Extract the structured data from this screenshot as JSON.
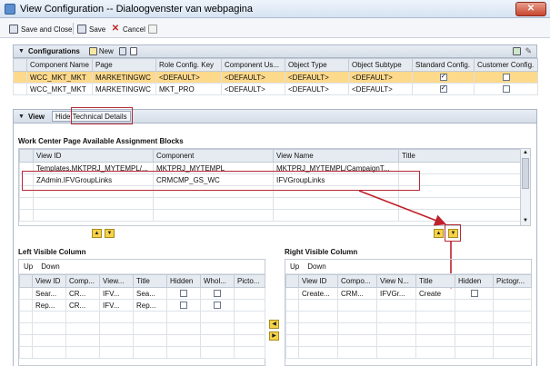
{
  "window": {
    "title": "View Configuration -- Dialoogvenster van webpagina"
  },
  "toolbar": {
    "save_close": "Save and Close",
    "save": "Save",
    "cancel": "Cancel"
  },
  "configurations": {
    "title": "Configurations",
    "new_label": "New",
    "columns": [
      "Component Name",
      "Page",
      "Role Config. Key",
      "Component Us...",
      "Object Type",
      "Object Subtype",
      "Standard Config.",
      "Customer Config."
    ],
    "rows": [
      [
        "WCC_MKT_MKT",
        "MARKETINGWC",
        "<DEFAULT>",
        "<DEFAULT>",
        "<DEFAULT>",
        "<DEFAULT>"
      ],
      [
        "WCC_MKT_MKT",
        "MARKETINGWC",
        "MKT_PRO",
        "<DEFAULT>",
        "<DEFAULT>",
        "<DEFAULT>"
      ]
    ],
    "standard_checked": [
      true,
      true
    ],
    "customer_checked": [
      false,
      false
    ]
  },
  "view": {
    "title": "View",
    "hide_tech": "Hide Technical Details",
    "wc_title": "Work Center Page Available Assignment Blocks",
    "wc_columns": [
      "View ID",
      "Component",
      "View Name",
      "Title"
    ],
    "wc_rows": [
      [
        "Templates.MKTPRJ_MYTEMPL/...",
        "MKTPRJ_MYTEMPL",
        "MKTPRJ_MYTEMPL/CampaignT...",
        ""
      ],
      [
        "ZAdmin.IFVGroupLinks",
        "CRMCMP_GS_WC",
        "IFVGroupLinks",
        ""
      ]
    ],
    "left_title": "Left Visible Column",
    "right_title": "Right Visible Column",
    "up": "Up",
    "down": "Down",
    "left_columns": [
      "View ID",
      "Comp...",
      "View...",
      "Title",
      "Hidden",
      "Whol...",
      "Picto..."
    ],
    "left_rows": [
      [
        "Sear...",
        "CR...",
        "IFV...",
        "Sea..."
      ],
      [
        "Rep...",
        "CR...",
        "IFV...",
        "Rep..."
      ]
    ],
    "right_columns": [
      "View ID",
      "Compo...",
      "View N...",
      "Title",
      "Hidden",
      "Pictogr..."
    ],
    "right_rows": [
      [
        "Create...",
        "CRM...",
        "IFVGr...",
        "Create"
      ]
    ]
  }
}
